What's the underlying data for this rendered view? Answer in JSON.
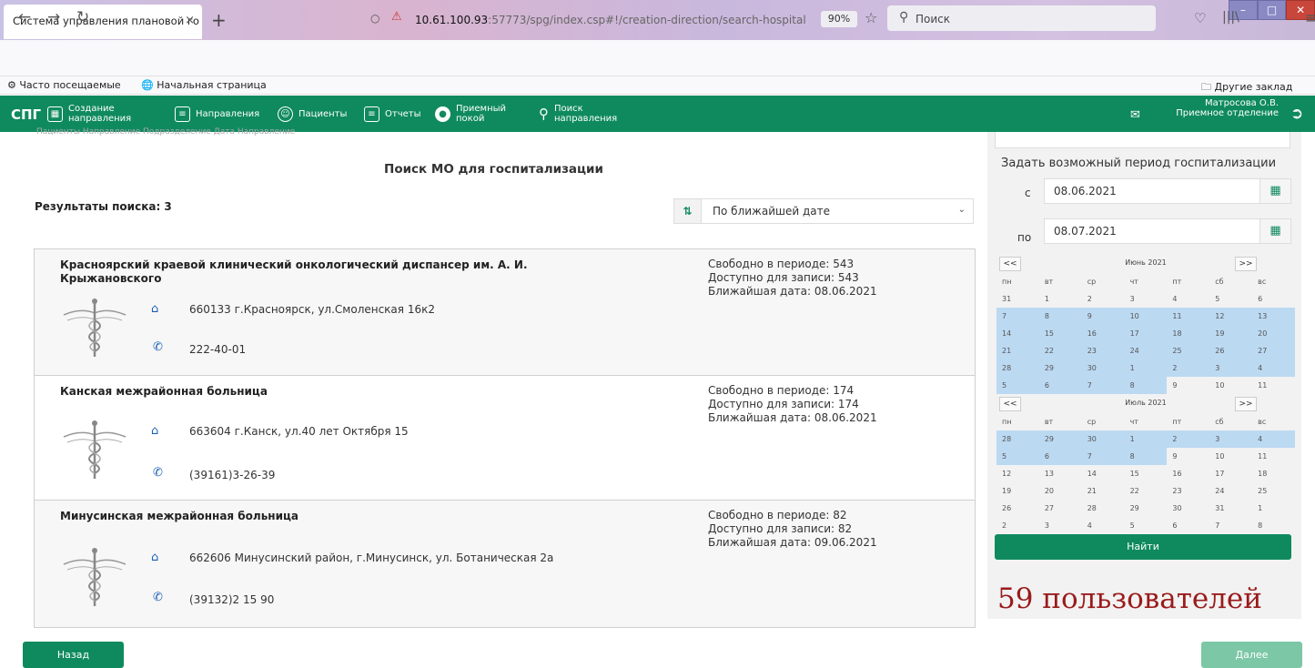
{
  "browser": {
    "tab_title": "Система управления плановой го",
    "tab_close": "×",
    "new_tab": "+",
    "url_host": "10.61.100.93",
    "url_path": ":57773/spg/index.csp#!/creation-direction/search-hospital",
    "zoom": "90%",
    "search_placeholder": "Поиск",
    "bookmarks": [
      "Часто посещаемые",
      "Начальная страница"
    ],
    "other_bookmarks": "Другие заклад"
  },
  "app": {
    "logo": "СПГ",
    "nav": [
      {
        "label": "Создание направления",
        "icon": "plus-square-icon"
      },
      {
        "label": "Направления",
        "icon": "document-icon"
      },
      {
        "label": "Пациенты",
        "icon": "users-icon"
      },
      {
        "label": "Отчеты",
        "icon": "report-icon"
      },
      {
        "label": "Приемный покой",
        "icon": "ambulance-icon"
      },
      {
        "label": "Поиск направления",
        "icon": "search-icon"
      }
    ],
    "user_name": "Матросова О.В.",
    "user_dept": "Приемное отделение"
  },
  "main": {
    "breadcrumb": "Пациенты     Направление     Подразделение     Дата                        Направление",
    "title": "Поиск МО для госпитализации",
    "results_label": "Результаты поиска: 3",
    "sort_value": "По ближайшей дате",
    "results": [
      {
        "name": "Красноярский краевой клинический онкологический диспансер им. А. И. Крыжановского",
        "address": "660133 г.Красноярск, ул.Смоленская 16к2",
        "phone": "222-40-01",
        "free": "Свободно в периоде: 543",
        "available": "Доступно для записи: 543",
        "nearest": "Ближайшая дата: 08.06.2021"
      },
      {
        "name": "Канская межрайонная больница",
        "address": "663604 г.Канск, ул.40 лет Октября 15",
        "phone": "(39161)3-26-39",
        "free": "Свободно в периоде: 174",
        "available": "Доступно для записи: 174",
        "nearest": "Ближайшая дата: 08.06.2021"
      },
      {
        "name": "Минусинская межрайонная больница",
        "address": "662606 Минусинский район, г.Минусинск, ул. Ботаническая 2а",
        "phone": "(39132)2 15 90",
        "free": "Свободно в периоде: 82",
        "available": "Доступно для записи: 82",
        "nearest": "Ближайшая дата: 09.06.2021"
      }
    ]
  },
  "period": {
    "title": "Задать возможный период госпитализации",
    "from_label": "с",
    "from_value": "08.06.2021",
    "to_label": "по",
    "to_value": "08.07.2021",
    "prev": "<<",
    "next": ">>",
    "dow": [
      "пн",
      "вт",
      "ср",
      "чт",
      "пт",
      "сб",
      "вс"
    ],
    "months": [
      {
        "name": "Июнь 2021",
        "days": [
          "31",
          "1",
          "2",
          "3",
          "4",
          "5",
          "6",
          "7",
          "8",
          "9",
          "10",
          "11",
          "12",
          "13",
          "14",
          "15",
          "16",
          "17",
          "18",
          "19",
          "20",
          "21",
          "22",
          "23",
          "24",
          "25",
          "26",
          "27",
          "28",
          "29",
          "30",
          "1",
          "2",
          "3",
          "4",
          "5",
          "6",
          "7",
          "8",
          "9",
          "10",
          "11"
        ]
      },
      {
        "name": "Июль 2021",
        "days": [
          "28",
          "29",
          "30",
          "1",
          "2",
          "3",
          "4",
          "5",
          "6",
          "7",
          "8",
          "9",
          "10",
          "11",
          "12",
          "13",
          "14",
          "15",
          "16",
          "17",
          "18",
          "19",
          "20",
          "21",
          "22",
          "23",
          "24",
          "25",
          "26",
          "27",
          "28",
          "29",
          "30",
          "31",
          "1",
          "2",
          "3",
          "4",
          "5",
          "6",
          "7",
          "8"
        ]
      }
    ],
    "find_label": "Найти"
  },
  "overlay_text": "59 пользователей",
  "footer": {
    "back_label": "Назад",
    "next_label": "Далее"
  },
  "colors": {
    "brand": "#0f8a5f",
    "selected_day": "#bcd9f2",
    "overlay": "#9a1b1b"
  }
}
